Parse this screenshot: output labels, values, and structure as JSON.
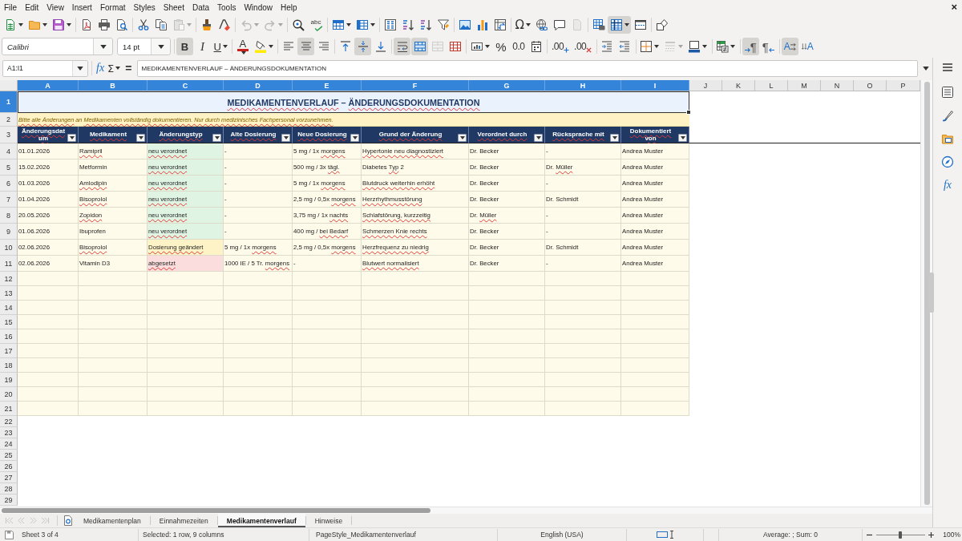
{
  "menu": {
    "items": [
      "File",
      "Edit",
      "View",
      "Insert",
      "Format",
      "Styles",
      "Sheet",
      "Data",
      "Tools",
      "Window",
      "Help"
    ],
    "close": "×"
  },
  "standard_toolbar": [
    [
      {
        "kind": "new",
        "pressed": false,
        "disabled": false,
        "dropdown": true
      },
      {
        "kind": "open",
        "pressed": false,
        "disabled": false,
        "dropdown": true
      },
      {
        "kind": "save",
        "pressed": false,
        "disabled": false,
        "dropdown": true
      }
    ],
    [
      {
        "kind": "export-pdf",
        "pressed": false,
        "disabled": false
      },
      {
        "kind": "print",
        "pressed": false,
        "disabled": false
      },
      {
        "kind": "print-preview",
        "pressed": false,
        "disabled": false
      }
    ],
    [
      {
        "kind": "cut",
        "pressed": false,
        "disabled": false
      },
      {
        "kind": "copy",
        "pressed": false,
        "disabled": false
      },
      {
        "kind": "paste",
        "pressed": false,
        "disabled": true,
        "dropdown": true
      }
    ],
    [
      {
        "kind": "clone-formatting",
        "pressed": false,
        "disabled": false
      },
      {
        "kind": "clear-formatting",
        "pressed": false,
        "disabled": false
      }
    ],
    [
      {
        "kind": "undo",
        "pressed": false,
        "disabled": true,
        "dropdown": true
      },
      {
        "kind": "redo",
        "pressed": false,
        "disabled": true,
        "dropdown": true
      }
    ],
    [
      {
        "kind": "find-replace",
        "pressed": false,
        "disabled": false
      },
      {
        "kind": "spelling",
        "label": "abc",
        "pressed": false,
        "disabled": false
      }
    ],
    [
      {
        "kind": "rows",
        "pressed": false,
        "disabled": false,
        "dropdown": true
      },
      {
        "kind": "columns",
        "pressed": false,
        "disabled": false,
        "dropdown": true
      }
    ],
    [
      {
        "kind": "sort",
        "pressed": false,
        "disabled": false
      },
      {
        "kind": "sort-ascending",
        "pressed": false,
        "disabled": false
      },
      {
        "kind": "sort-descending",
        "pressed": false,
        "disabled": false
      },
      {
        "kind": "autofilter",
        "pressed": false,
        "disabled": false
      }
    ],
    [
      {
        "kind": "image",
        "pressed": false,
        "disabled": false
      },
      {
        "kind": "chart",
        "pressed": false,
        "disabled": false
      },
      {
        "kind": "pivot-table",
        "pressed": false,
        "disabled": false
      }
    ],
    [
      {
        "kind": "special-character",
        "label": "Ω",
        "pressed": false,
        "disabled": false,
        "dropdown": true
      },
      {
        "kind": "hyperlink",
        "pressed": false,
        "disabled": false
      },
      {
        "kind": "comment",
        "pressed": false,
        "disabled": false
      },
      {
        "kind": "headers-footers",
        "pressed": false,
        "disabled": true
      }
    ],
    [
      {
        "kind": "print-area",
        "pressed": false,
        "disabled": false
      },
      {
        "kind": "freeze",
        "pressed": true,
        "disabled": false,
        "dropdown": true
      },
      {
        "kind": "split-window",
        "pressed": false,
        "disabled": false
      }
    ],
    [
      {
        "kind": "shapes",
        "pressed": false,
        "disabled": false
      }
    ]
  ],
  "formatting_toolbar": {
    "font_name": "Calibri",
    "font_size": "14 pt",
    "groups": [
      [
        {
          "kind": "bold",
          "label": "B",
          "pressed": true,
          "disabled": false
        },
        {
          "kind": "italic",
          "label": "I",
          "pressed": false,
          "disabled": false
        },
        {
          "kind": "underline",
          "label": "U",
          "pressed": false,
          "disabled": false,
          "dropdown": true
        }
      ],
      [
        {
          "kind": "font-color",
          "label": "A",
          "pressed": false,
          "disabled": false,
          "dropdown": true
        },
        {
          "kind": "highlight",
          "pressed": false,
          "disabled": false,
          "dropdown": true
        }
      ],
      [
        {
          "kind": "align-left",
          "pressed": false,
          "disabled": false
        },
        {
          "kind": "align-center",
          "pressed": true,
          "disabled": false
        },
        {
          "kind": "align-right",
          "pressed": false,
          "disabled": false
        }
      ],
      [
        {
          "kind": "align-top",
          "pressed": false,
          "disabled": false
        },
        {
          "kind": "align-middle",
          "pressed": true,
          "disabled": false
        },
        {
          "kind": "align-bottom",
          "pressed": false,
          "disabled": false
        }
      ],
      [
        {
          "kind": "wrap-text",
          "pressed": true,
          "disabled": false
        },
        {
          "kind": "merge-center",
          "pressed": true,
          "disabled": false
        },
        {
          "kind": "merge-cells",
          "pressed": false,
          "disabled": true
        },
        {
          "kind": "unmerge-cells",
          "pressed": false,
          "disabled": false
        }
      ],
      [
        {
          "kind": "currency",
          "pressed": false,
          "disabled": false,
          "dropdown": true
        },
        {
          "kind": "percent",
          "label": "%",
          "pressed": false,
          "disabled": false
        },
        {
          "kind": "number",
          "label": "0.0",
          "pressed": false,
          "disabled": false
        },
        {
          "kind": "date",
          "pressed": false,
          "disabled": false
        }
      ],
      [
        {
          "kind": "add-decimal",
          "label": ".00",
          "pressed": false,
          "disabled": false
        },
        {
          "kind": "delete-decimal",
          "label": ".00",
          "pressed": false,
          "disabled": false
        }
      ],
      [
        {
          "kind": "indent",
          "pressed": false,
          "disabled": false
        },
        {
          "kind": "outdent",
          "pressed": false,
          "disabled": false
        }
      ],
      [
        {
          "kind": "borders",
          "pressed": false,
          "disabled": false,
          "dropdown": true
        },
        {
          "kind": "border-style",
          "pressed": false,
          "disabled": true,
          "dropdown": true
        },
        {
          "kind": "border-color",
          "pressed": false,
          "disabled": false,
          "dropdown": true
        }
      ],
      [
        {
          "kind": "conditional",
          "pressed": false,
          "disabled": false,
          "dropdown": true
        }
      ],
      [
        {
          "kind": "left-to-right",
          "label": "¶",
          "pressed": true,
          "disabled": false
        },
        {
          "kind": "right-to-left",
          "label": "¶",
          "pressed": false,
          "disabled": false
        }
      ],
      [
        {
          "kind": "text-horizontal",
          "label": "A",
          "pressed": true,
          "disabled": false
        },
        {
          "kind": "text-vertical",
          "label": "A",
          "pressed": false,
          "disabled": false
        }
      ]
    ]
  },
  "formula_bar": {
    "name_box": "A1:I1",
    "wizard": "fx",
    "sum": "Σ",
    "equals": "=",
    "formula": "MEDIKAMENTENVERLAUF – ÄNDERUNGSDOKUMENTATION"
  },
  "sidebar": {
    "tabs": [
      {
        "kind": "properties"
      },
      {
        "kind": "styles"
      },
      {
        "kind": "gallery"
      },
      {
        "kind": "navigator"
      },
      {
        "kind": "functions",
        "label": "fx"
      }
    ]
  },
  "sheet": {
    "columns": [
      {
        "label": "A",
        "selected": true
      },
      {
        "label": "B",
        "selected": true
      },
      {
        "label": "C",
        "selected": true
      },
      {
        "label": "D",
        "selected": true
      },
      {
        "label": "E",
        "selected": true
      },
      {
        "label": "F",
        "selected": true
      },
      {
        "label": "G",
        "selected": true
      },
      {
        "label": "H",
        "selected": true
      },
      {
        "label": "I",
        "selected": true
      },
      {
        "label": "J",
        "selected": false
      },
      {
        "label": "K",
        "selected": false
      },
      {
        "label": "L",
        "selected": false
      },
      {
        "label": "M",
        "selected": false
      },
      {
        "label": "N",
        "selected": false
      },
      {
        "label": "O",
        "selected": false
      },
      {
        "label": "P",
        "selected": false
      }
    ],
    "rows": [
      {
        "label": "1",
        "selected": true
      },
      {
        "label": "2",
        "selected": false
      },
      {
        "label": "3",
        "selected": false
      },
      {
        "label": "4",
        "selected": false
      },
      {
        "label": "5",
        "selected": false
      },
      {
        "label": "6",
        "selected": false
      },
      {
        "label": "7",
        "selected": false
      },
      {
        "label": "8",
        "selected": false
      },
      {
        "label": "9",
        "selected": false
      },
      {
        "label": "10",
        "selected": false
      },
      {
        "label": "11",
        "selected": false
      },
      {
        "label": "12",
        "selected": false
      },
      {
        "label": "13",
        "selected": false
      },
      {
        "label": "14",
        "selected": false
      },
      {
        "label": "15",
        "selected": false
      },
      {
        "label": "16",
        "selected": false
      },
      {
        "label": "17",
        "selected": false
      },
      {
        "label": "18",
        "selected": false
      },
      {
        "label": "19",
        "selected": false
      },
      {
        "label": "20",
        "selected": false
      },
      {
        "label": "21",
        "selected": false
      },
      {
        "label": "22",
        "selected": false
      },
      {
        "label": "23",
        "selected": false
      },
      {
        "label": "24",
        "selected": false
      },
      {
        "label": "25",
        "selected": false
      },
      {
        "label": "26",
        "selected": false
      },
      {
        "label": "27",
        "selected": false
      },
      {
        "label": "28",
        "selected": false
      },
      {
        "label": "29",
        "selected": false
      }
    ],
    "title": {
      "selected": true,
      "parts": [
        {
          "text": "MEDIKAMENTENVERLAUF",
          "misspelled": true
        },
        {
          "text": " – ",
          "misspelled": false
        },
        {
          "text": "ÄNDERUNGSDOKUMENTATION",
          "misspelled": true
        }
      ]
    },
    "note": {
      "parts": [
        {
          "text": "Bitte alle Änderungen",
          "misspelled": true
        },
        {
          "text": " an ",
          "misspelled": false
        },
        {
          "text": "Medikamenten vollständig dokumentieren. Nur durch medizinisches Fachpersonal vorzunehmen.",
          "misspelled": true
        }
      ]
    },
    "headers": [
      {
        "text": "Änderungsdatum",
        "misspelled": true
      },
      {
        "text": "Medikament",
        "misspelled": true
      },
      {
        "text": "Änderungstyp",
        "misspelled": true
      },
      {
        "text": "Alte Dosierung",
        "misspelled": true
      },
      {
        "text": "Neue Dosierung",
        "misspelled": true
      },
      {
        "text": "Grund der Änderung",
        "misspelled": true
      },
      {
        "text": "Verordnet durch",
        "misspelled": true
      },
      {
        "text": "Rücksprache mit",
        "misspelled": true
      },
      {
        "text": "Dokumentiert von",
        "misspelled": true
      }
    ],
    "records": [
      [
        {
          "text": "01.01.2026",
          "misspelled": false
        },
        {
          "text": "Ramipril",
          "misspelled": true
        },
        {
          "text": "neu verordnet",
          "misspelled": true,
          "color": "#dff4e3"
        },
        {
          "text": "-",
          "misspelled": false
        },
        {
          "parts": [
            {
              "text": "5 mg / 1x ",
              "misspelled": false
            },
            {
              "text": "morgens",
              "misspelled": true
            }
          ]
        },
        {
          "text": "Hypertonie neu diagnostiziert",
          "misspelled": true
        },
        {
          "text": "Dr. Becker",
          "misspelled": false
        },
        {
          "text": "-",
          "misspelled": false
        },
        {
          "text": "Andrea Muster",
          "misspelled": false
        }
      ],
      [
        {
          "text": "15.02.2026",
          "misspelled": false
        },
        {
          "text": "Metformin",
          "misspelled": false
        },
        {
          "text": "neu verordnet",
          "misspelled": true,
          "color": "#dff4e3"
        },
        {
          "text": "-",
          "misspelled": false
        },
        {
          "parts": [
            {
              "text": "500 mg / 3x ",
              "misspelled": false
            },
            {
              "text": "tägl.",
              "misspelled": true
            }
          ]
        },
        {
          "parts": [
            {
              "text": "Diabetes ",
              "misspelled": false
            },
            {
              "text": "Typ",
              "misspelled": true
            },
            {
              "text": " 2",
              "misspelled": false
            }
          ]
        },
        {
          "text": "Dr. Becker",
          "misspelled": false
        },
        {
          "parts": [
            {
              "text": "Dr. ",
              "misspelled": false
            },
            {
              "text": "Müller",
              "misspelled": true
            }
          ]
        },
        {
          "text": "Andrea Muster",
          "misspelled": false
        }
      ],
      [
        {
          "text": "01.03.2026",
          "misspelled": false
        },
        {
          "text": "Amlodipin",
          "misspelled": true
        },
        {
          "text": "neu verordnet",
          "misspelled": true,
          "color": "#dff4e3"
        },
        {
          "text": "-",
          "misspelled": false
        },
        {
          "parts": [
            {
              "text": "5 mg / 1x ",
              "misspelled": false
            },
            {
              "text": "morgens",
              "misspelled": true
            }
          ]
        },
        {
          "text": "Blutdruck weiterhin erhöht",
          "misspelled": true
        },
        {
          "text": "Dr. Becker",
          "misspelled": false
        },
        {
          "text": "-",
          "misspelled": false
        },
        {
          "text": "Andrea Muster",
          "misspelled": false
        }
      ],
      [
        {
          "text": "01.04.2026",
          "misspelled": false
        },
        {
          "text": "Bisoprolol",
          "misspelled": true
        },
        {
          "text": "neu verordnet",
          "misspelled": true,
          "color": "#dff4e3"
        },
        {
          "text": "-",
          "misspelled": false
        },
        {
          "parts": [
            {
              "text": "2,5 mg / 0,5x ",
              "misspelled": false
            },
            {
              "text": "morgens",
              "misspelled": true
            }
          ]
        },
        {
          "text": "Herzrhythmusstörung",
          "misspelled": true
        },
        {
          "text": "Dr. Becker",
          "misspelled": false
        },
        {
          "text": "Dr. Schmidt",
          "misspelled": false
        },
        {
          "text": "Andrea Muster",
          "misspelled": false
        }
      ],
      [
        {
          "text": "20.05.2026",
          "misspelled": false
        },
        {
          "text": "Zopidon",
          "misspelled": true
        },
        {
          "text": "neu verordnet",
          "misspelled": true,
          "color": "#dff4e3"
        },
        {
          "text": "-",
          "misspelled": false
        },
        {
          "parts": [
            {
              "text": "3,75 mg / 1x ",
              "misspelled": false
            },
            {
              "text": "nachts",
              "misspelled": true
            }
          ]
        },
        {
          "text": "Schlafstörung, kurzzeitig",
          "misspelled": true
        },
        {
          "parts": [
            {
              "text": "Dr. ",
              "misspelled": false
            },
            {
              "text": "Müller",
              "misspelled": true
            }
          ]
        },
        {
          "text": "-",
          "misspelled": false
        },
        {
          "text": "Andrea Muster",
          "misspelled": false
        }
      ],
      [
        {
          "text": "01.06.2026",
          "misspelled": false
        },
        {
          "text": "Ibuprofen",
          "misspelled": false
        },
        {
          "text": "neu verordnet",
          "misspelled": true,
          "color": "#dff4e3"
        },
        {
          "text": "-",
          "misspelled": false
        },
        {
          "parts": [
            {
              "text": "400 mg / ",
              "misspelled": false
            },
            {
              "text": "bei Bedarf",
              "misspelled": true
            }
          ]
        },
        {
          "text": "Schmerzen Knie rechts",
          "misspelled": true
        },
        {
          "text": "Dr. Becker",
          "misspelled": false
        },
        {
          "text": "-",
          "misspelled": false
        },
        {
          "text": "Andrea Muster",
          "misspelled": false
        }
      ],
      [
        {
          "text": "02.06.2026",
          "misspelled": false
        },
        {
          "text": "Bisoprolol",
          "misspelled": true
        },
        {
          "text": "Dosierung geändert",
          "misspelled": true,
          "color": "#fdf3c6"
        },
        {
          "parts": [
            {
              "text": "5 mg / 1x ",
              "misspelled": false
            },
            {
              "text": "morgens",
              "misspelled": true
            }
          ]
        },
        {
          "parts": [
            {
              "text": "2,5 mg / 0,5x ",
              "misspelled": false
            },
            {
              "text": "morgens",
              "misspelled": true
            }
          ]
        },
        {
          "text": "Herzfrequenz zu niedrig",
          "misspelled": true
        },
        {
          "text": "Dr. Becker",
          "misspelled": false
        },
        {
          "text": "Dr. Schmidt",
          "misspelled": false
        },
        {
          "text": "Andrea Muster",
          "misspelled": false
        }
      ],
      [
        {
          "text": "02.06.2026",
          "misspelled": false
        },
        {
          "text": "Vitamin D3",
          "misspelled": false
        },
        {
          "text": "abgesetzt",
          "misspelled": true,
          "color": "#fbdddd"
        },
        {
          "parts": [
            {
              "text": "1000 IE / 5 Tr. ",
              "misspelled": false
            },
            {
              "text": "morgens",
              "misspelled": true
            }
          ]
        },
        {
          "text": "-",
          "misspelled": false
        },
        {
          "text": "Blutwert normalisiert",
          "misspelled": true
        },
        {
          "text": "Dr. Becker",
          "misspelled": false
        },
        {
          "text": "-",
          "misspelled": false
        },
        {
          "text": "Andrea Muster",
          "misspelled": false
        }
      ]
    ]
  },
  "sheet_tabs": {
    "navigation": [
      {
        "kind": "first",
        "disabled": true
      },
      {
        "kind": "previous",
        "disabled": true
      },
      {
        "kind": "next",
        "disabled": true
      },
      {
        "kind": "last",
        "disabled": true
      }
    ],
    "tabs": [
      {
        "label": "Medikamentenplan",
        "selected": false
      },
      {
        "label": "Einnahmezeiten",
        "selected": false
      },
      {
        "label": "Medikamentenverlauf",
        "selected": true
      },
      {
        "label": "Hinweise",
        "selected": false
      }
    ]
  },
  "status_bar": {
    "sheet": "Sheet 3 of 4",
    "selection": "Selected: 1 row, 9 columns",
    "page_style": "PageStyle_Medikamentenverlauf",
    "language": "English (USA)",
    "summary": "Average: ; Sum: 0",
    "zoom_slider": {
      "level": 0.5
    },
    "zoom": "100%"
  }
}
